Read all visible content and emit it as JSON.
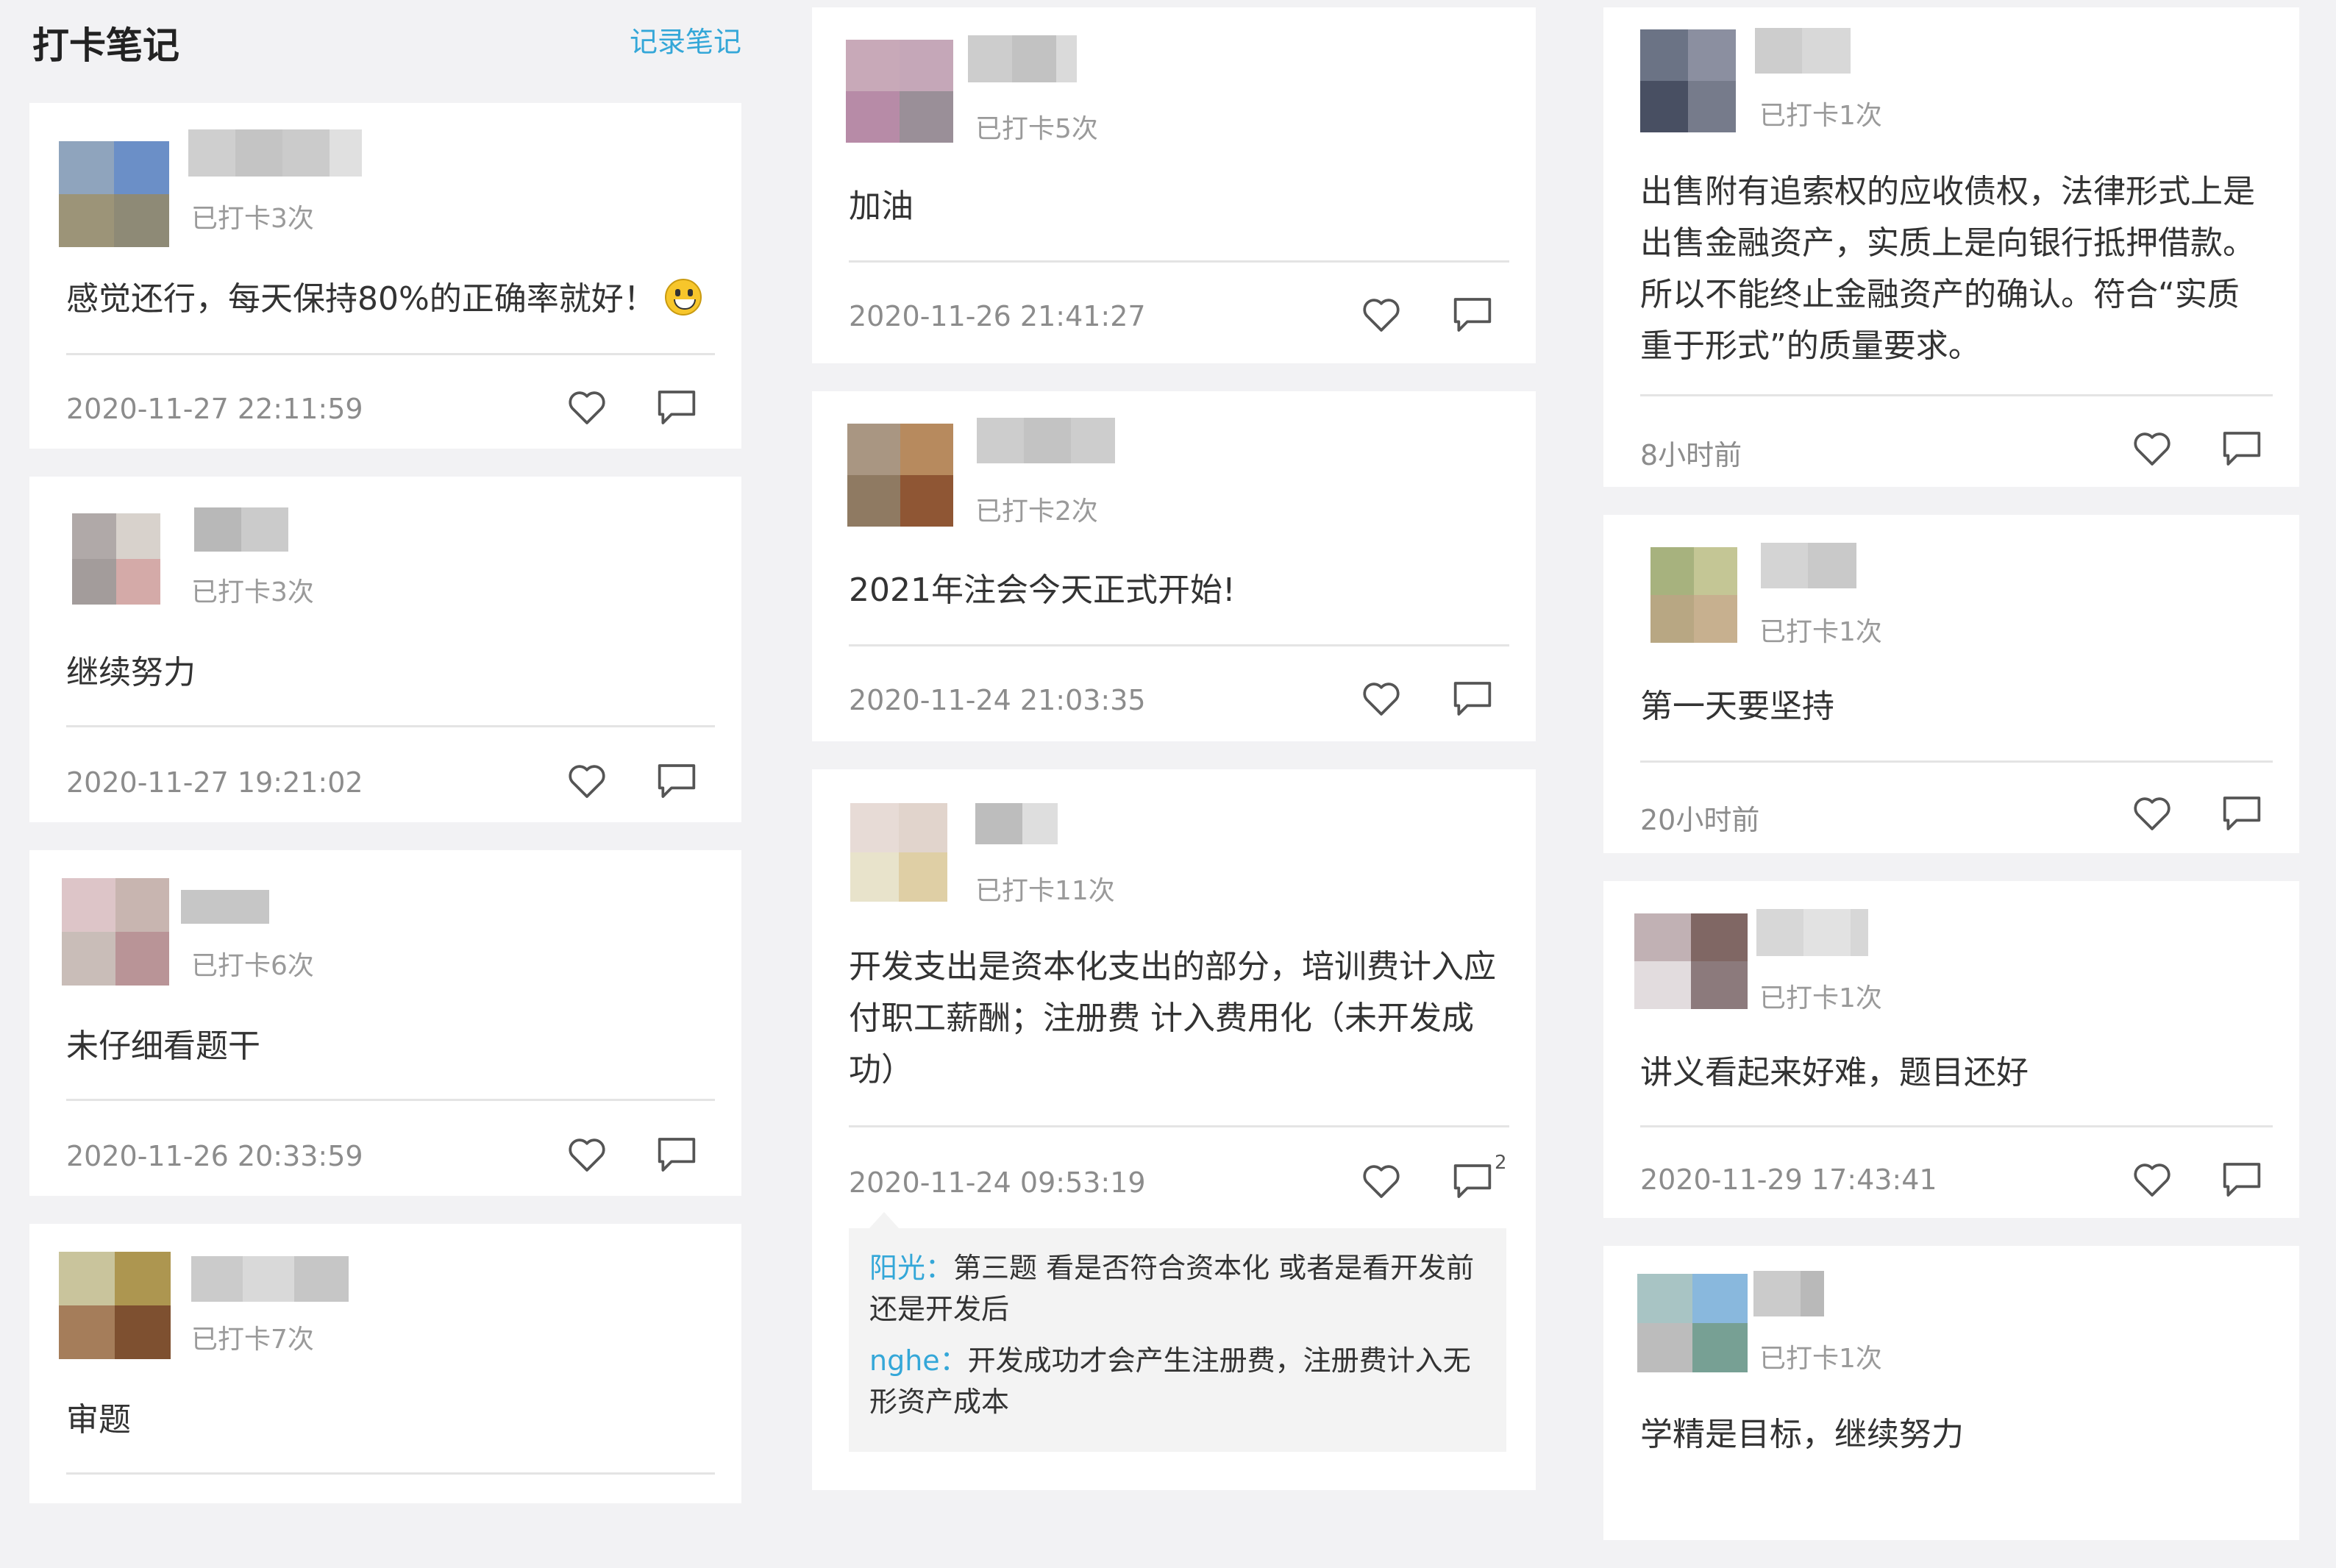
{
  "page": {
    "title": "打卡笔记",
    "record_link": "记录笔记"
  },
  "ui": {
    "accent_color": "#34a7d8",
    "like_icon": "heart-outline-icon",
    "comment_icon": "speech-bubble-icon"
  },
  "columns": [
    {
      "cards": [
        {
          "checkin": "已打卡3次",
          "content": "感觉还行，每天保持80%的正确率就好！",
          "emoji": "grinning-face-emoji",
          "time": "2020-11-27 22:11:59"
        },
        {
          "checkin": "已打卡3次",
          "content": "继续努力",
          "time": "2020-11-27 19:21:02"
        },
        {
          "checkin": "已打卡6次",
          "content": "未仔细看题干",
          "time": "2020-11-26 20:33:59"
        },
        {
          "checkin": "已打卡7次",
          "content": "审题",
          "time": ""
        }
      ]
    },
    {
      "cards": [
        {
          "checkin": "已打卡5次",
          "content": "加油",
          "time": "2020-11-26 21:41:27"
        },
        {
          "checkin": "已打卡2次",
          "content": "2021年注会今天正式开始!",
          "time": "2020-11-24 21:03:35"
        },
        {
          "checkin": "已打卡11次",
          "content": "开发支出是资本化支出的部分，培训费计入应付职工薪酬；注册费 计入费用化（未开发成功）",
          "time": "2020-11-24 09:53:19",
          "comment_count": "2",
          "comments": [
            {
              "author": "阳光：",
              "text": "第三题 看是否符合资本化 或者是看开发前还是开发后"
            },
            {
              "author": "nghe：",
              "text": "开发成功才会产生注册费，注册费计入无形资产成本"
            }
          ]
        }
      ]
    },
    {
      "cards": [
        {
          "checkin": "已打卡1次",
          "content": "出售附有追索权的应收债权，法律形式上是出售金融资产，实质上是向银行抵押借款。所以不能终止金融资产的确认。符合“实质重于形式”的质量要求。",
          "time": "8小时前"
        },
        {
          "checkin": "已打卡1次",
          "content": "第一天要坚持",
          "time": "20小时前"
        },
        {
          "checkin": "已打卡1次",
          "content": "讲义看起来好难，题目还好",
          "time": "2020-11-29 17:43:41"
        },
        {
          "checkin": "已打卡1次",
          "content": "学精是目标，继续努力",
          "time": ""
        }
      ]
    }
  ]
}
